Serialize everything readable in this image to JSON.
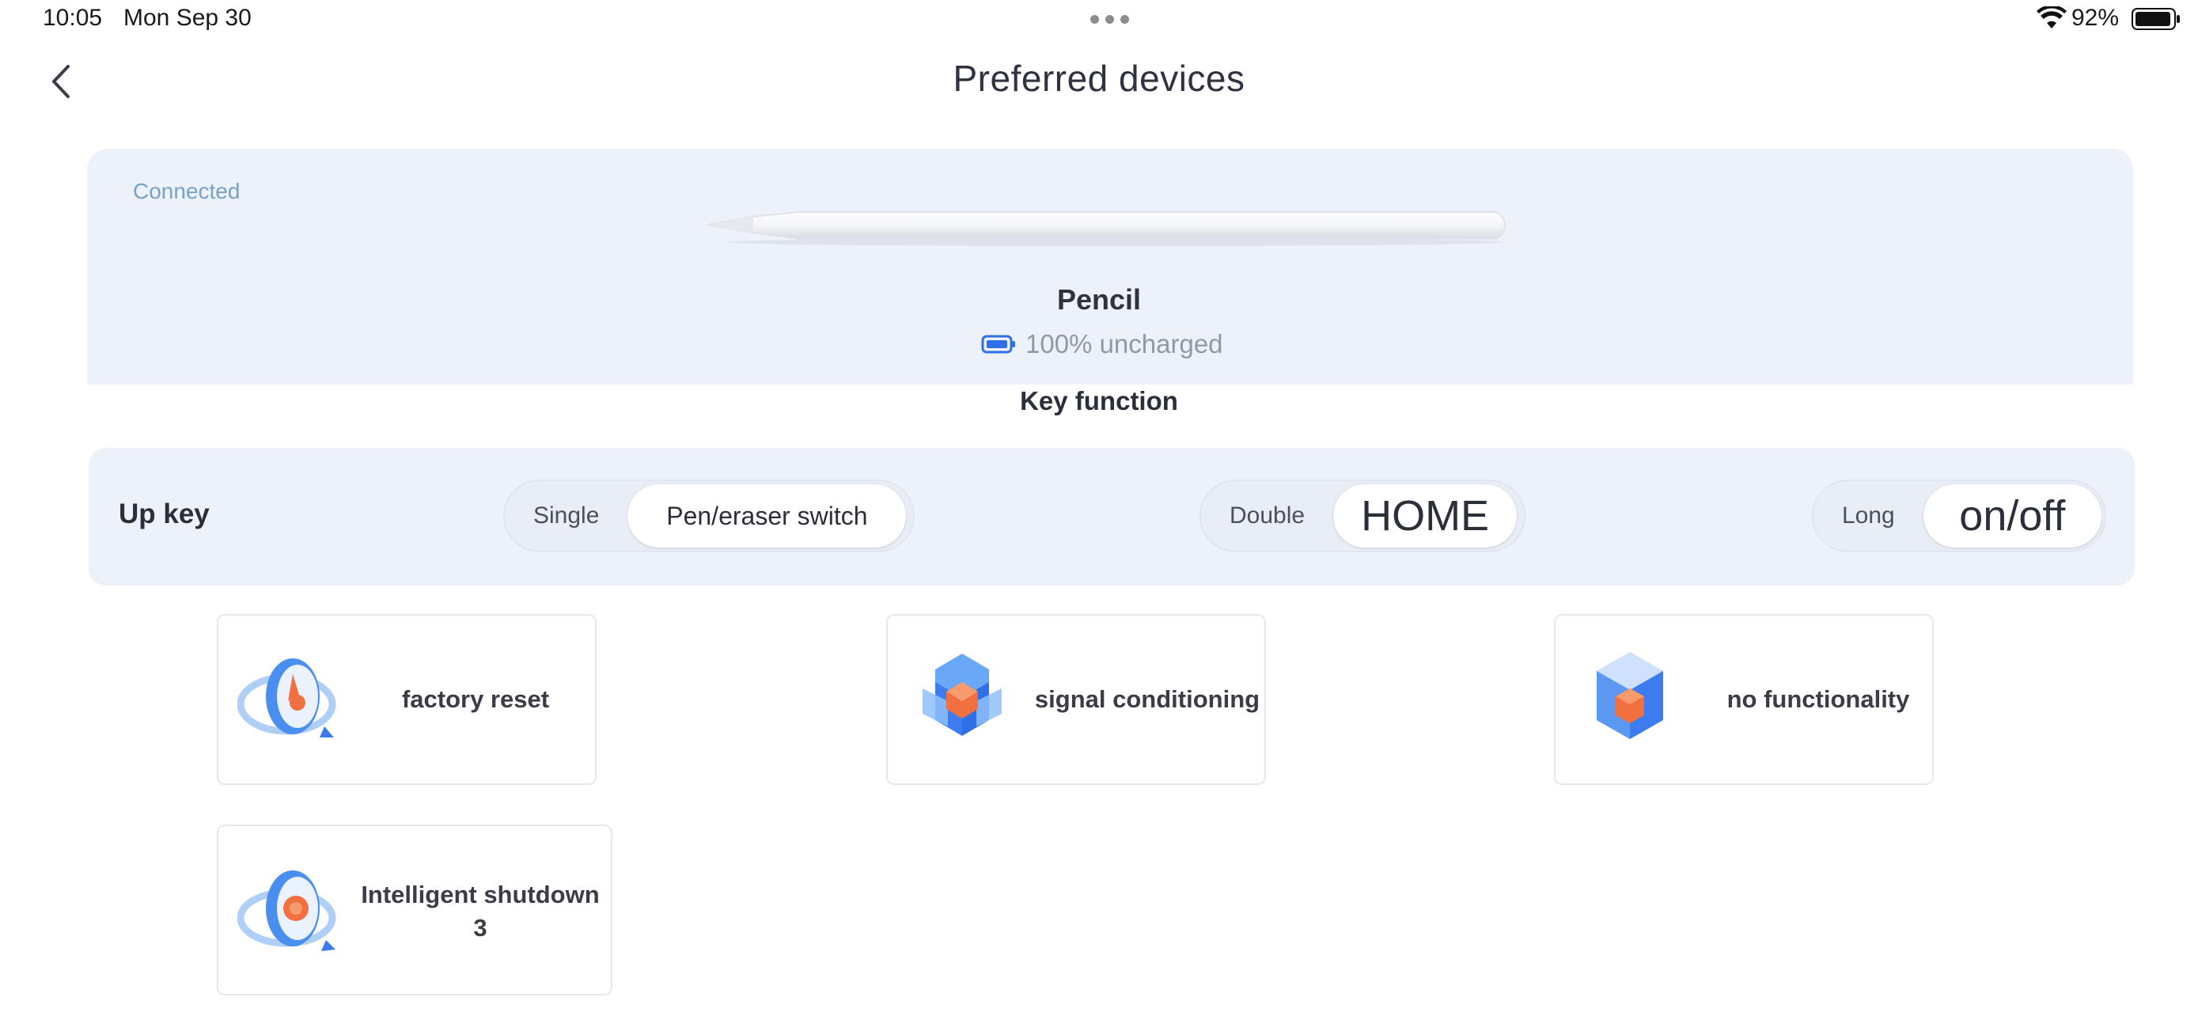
{
  "status_bar": {
    "time": "10:05",
    "date": "Mon Sep 30",
    "battery_percent": "92%",
    "icons": [
      "more-dots-icon",
      "wifi-icon",
      "battery-icon"
    ]
  },
  "header": {
    "title": "Preferred devices",
    "back_icon": "chevron-left-icon"
  },
  "device": {
    "status": "Connected",
    "name": "Pencil",
    "battery_text": "100% uncharged",
    "battery_level": 1.0
  },
  "key_function": {
    "heading": "Key function",
    "up_key": {
      "label": "Up key",
      "single_label": "Single",
      "single_value": "Pen/eraser switch",
      "double_label": "Double",
      "double_value": "HOME",
      "long_label": "Long",
      "long_value": "on/off"
    }
  },
  "functions": [
    {
      "label": "factory reset",
      "icon": "factory-reset-icon"
    },
    {
      "label": "signal conditioning",
      "icon": "signal-conditioning-icon"
    },
    {
      "label": "no functionality",
      "icon": "no-functionality-icon"
    },
    {
      "label": "Intelligent shutdown 3",
      "icon": "intelligent-shutdown-icon"
    }
  ],
  "colors": {
    "card_bg": "#edf1fa",
    "accent_blue": "#3d7cf0",
    "accent_orange": "#f2703f",
    "connected_text": "#78a3c6"
  }
}
